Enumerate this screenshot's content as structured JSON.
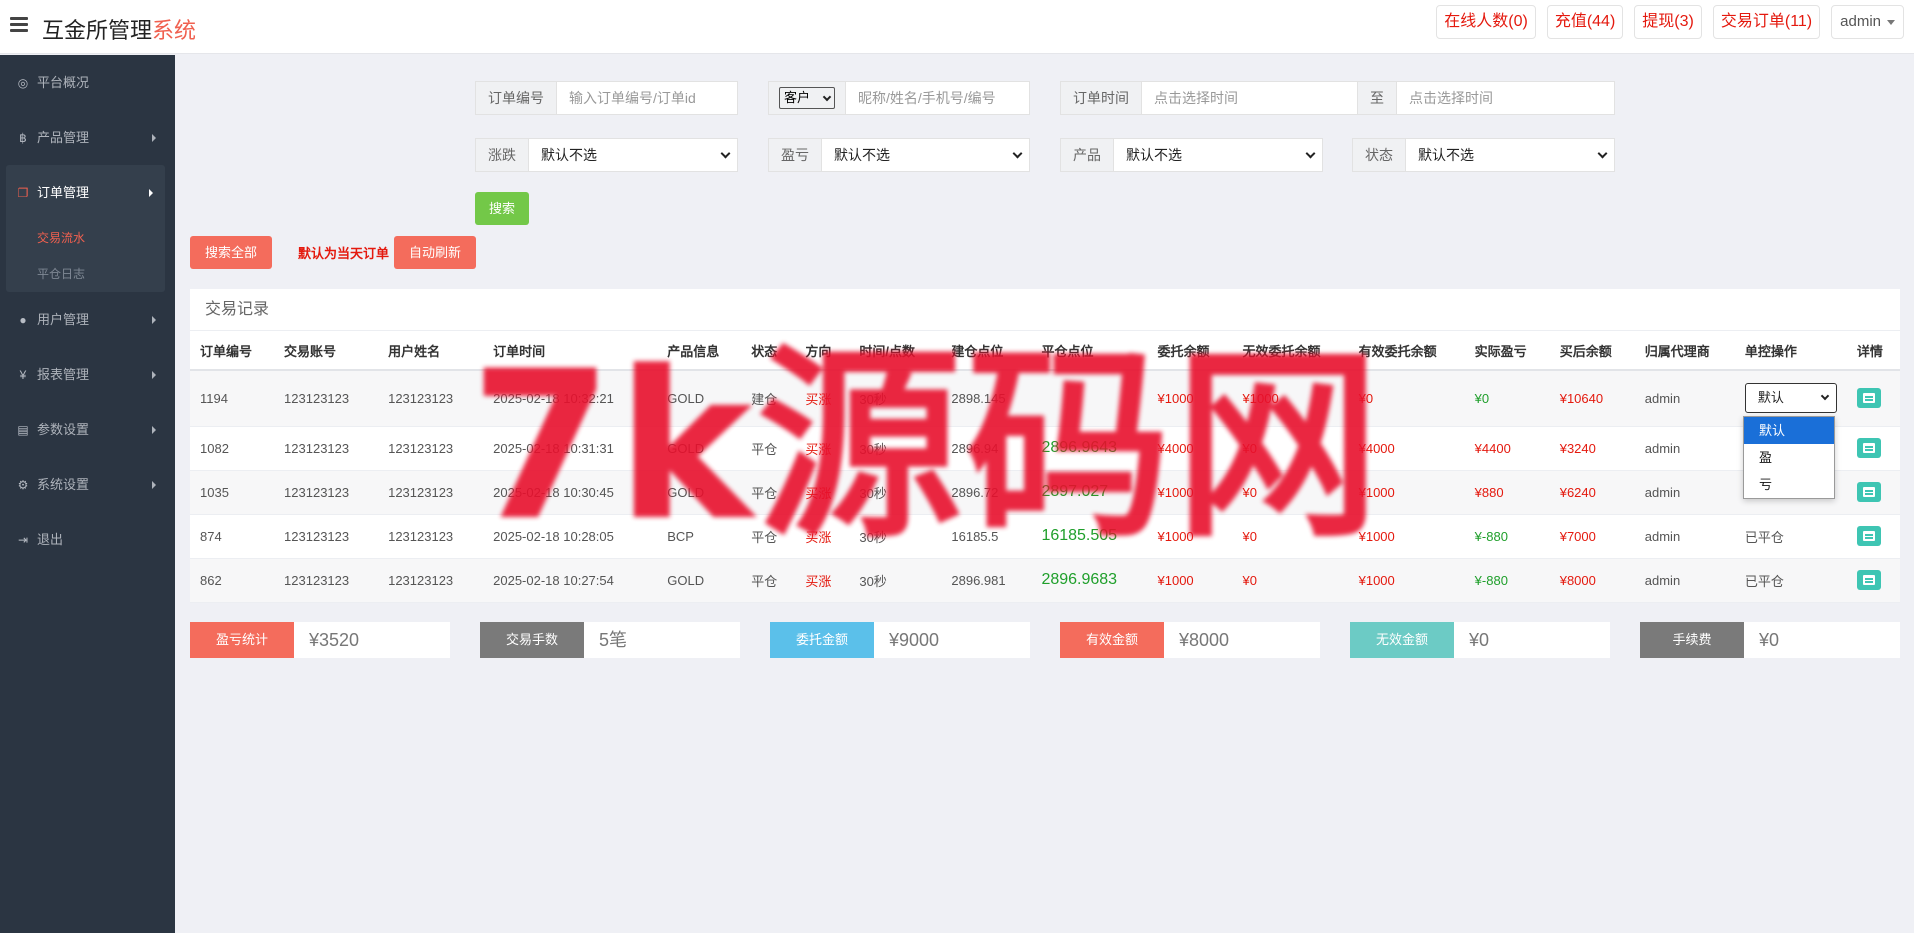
{
  "app": {
    "title_main": "互金所管理",
    "title_accent": "系统"
  },
  "header": {
    "online": "在线人数(0)",
    "recharge": "充值(44)",
    "withdraw": "提现(3)",
    "trade_orders": "交易订单(11)",
    "user": "admin"
  },
  "sidebar": {
    "items": [
      {
        "label": "平台概况",
        "icon": "dashboard-icon"
      },
      {
        "label": "产品管理",
        "icon": "bitcoin-icon"
      },
      {
        "label": "订单管理",
        "icon": "copy-icon"
      },
      {
        "label": "用户管理",
        "icon": "user-icon"
      },
      {
        "label": "报表管理",
        "icon": "yen-icon"
      },
      {
        "label": "参数设置",
        "icon": "file-icon"
      },
      {
        "label": "系统设置",
        "icon": "gears-icon"
      },
      {
        "label": "退出",
        "icon": "sign-out-icon"
      }
    ],
    "sub_items": [
      "交易流水",
      "平仓日志"
    ]
  },
  "filters": {
    "order_no_label": "订单编号",
    "order_no_placeholder": "输入订单编号/订单id",
    "customer_select": "客户",
    "customer_placeholder": "昵称/姓名/手机号/编号",
    "order_time_label": "订单时间",
    "order_time_placeholder": "点击选择时间",
    "to_label": "至",
    "to_placeholder": "点击选择时间",
    "rise_fall_label": "涨跌",
    "rise_fall_value": "默认不选",
    "profit_loss_label": "盈亏",
    "profit_loss_value": "默认不选",
    "product_label": "产品",
    "product_value": "默认不选",
    "status_label": "状态",
    "status_value": "默认不选",
    "search_button": "搜索"
  },
  "actions": {
    "search_all": "搜索全部",
    "today_note": "默认为当天订单",
    "auto_refresh": "自动刷新"
  },
  "table": {
    "title": "交易记录",
    "headers": [
      "订单编号",
      "交易账号",
      "用户姓名",
      "订单时间",
      "产品信息",
      "状态",
      "方向",
      "时间/点数",
      "建仓点位",
      "平仓点位",
      "委托余额",
      "无效委托余额",
      "有效委托余额",
      "实际盈亏",
      "买后余额",
      "归属代理商",
      "单控操作",
      "详情"
    ],
    "rows": [
      {
        "id": "1194",
        "account": "123123123",
        "name": "123123123",
        "time": "2025-02-18 10:32:21",
        "product": "GOLD",
        "status": "建仓",
        "direction": "买涨",
        "period": "30秒",
        "open": "2898.145",
        "close": "",
        "entrust": "¥1000",
        "invalid": "¥1000",
        "valid": "¥0",
        "pnl": "¥0",
        "after": "¥10640",
        "agent": "admin",
        "control": "默认"
      },
      {
        "id": "1082",
        "account": "123123123",
        "name": "123123123",
        "time": "2025-02-18 10:31:31",
        "product": "GOLD",
        "status": "平仓",
        "direction": "买涨",
        "period": "30秒",
        "open": "2896.94",
        "close": "2896.9643",
        "entrust": "¥4000",
        "invalid": "¥0",
        "valid": "¥4000",
        "pnl": "¥4400",
        "after": "¥3240",
        "agent": "admin",
        "control": ""
      },
      {
        "id": "1035",
        "account": "123123123",
        "name": "123123123",
        "time": "2025-02-18 10:30:45",
        "product": "GOLD",
        "status": "平仓",
        "direction": "买涨",
        "period": "30秒",
        "open": "2896.72",
        "close": "2897.027",
        "entrust": "¥1000",
        "invalid": "¥0",
        "valid": "¥1000",
        "pnl": "¥880",
        "after": "¥6240",
        "agent": "admin",
        "control": ""
      },
      {
        "id": "874",
        "account": "123123123",
        "name": "123123123",
        "time": "2025-02-18 10:28:05",
        "product": "BCP",
        "status": "平仓",
        "direction": "买涨",
        "period": "30秒",
        "open": "16185.5",
        "close": "16185.505",
        "entrust": "¥1000",
        "invalid": "¥0",
        "valid": "¥1000",
        "pnl": "¥-880",
        "after": "¥7000",
        "agent": "admin",
        "control": "已平仓"
      },
      {
        "id": "862",
        "account": "123123123",
        "name": "123123123",
        "time": "2025-02-18 10:27:54",
        "product": "GOLD",
        "status": "平仓",
        "direction": "买涨",
        "period": "30秒",
        "open": "2896.981",
        "close": "2896.9683",
        "entrust": "¥1000",
        "invalid": "¥0",
        "valid": "¥1000",
        "pnl": "¥-880",
        "after": "¥8000",
        "agent": "admin",
        "control": "已平仓"
      }
    ]
  },
  "dropdown_options": [
    "默认",
    "盈",
    "亏"
  ],
  "stats": [
    {
      "label": "盈亏统计",
      "value": "¥3520",
      "color": "#f46c5c"
    },
    {
      "label": "交易手数",
      "value": "5笔",
      "color": "#7a7a7a"
    },
    {
      "label": "委托金额",
      "value": "¥9000",
      "color": "#5bc0ea"
    },
    {
      "label": "有效金额",
      "value": "¥8000",
      "color": "#f46c5c"
    },
    {
      "label": "无效金额",
      "value": "¥0",
      "color": "#6ccbc5"
    },
    {
      "label": "手续费",
      "value": "¥0",
      "color": "#7a7a7a"
    }
  ],
  "watermark": "7k源码网",
  "colors": {
    "accent": "#f0604f",
    "sidebar_bg": "#2b3542",
    "profit_green": "#1f9f2b",
    "loss_red": "#e4190e"
  }
}
